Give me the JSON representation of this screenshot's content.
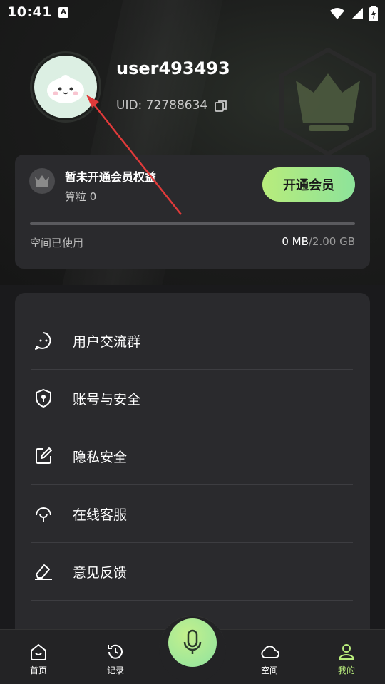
{
  "status_bar": {
    "time": "10:41",
    "a_badge": "A"
  },
  "profile": {
    "username": "user493493",
    "uid_label": "UID: 72788634"
  },
  "vip": {
    "title": "暂未开通会员权益",
    "points": "算粒 0",
    "button_label": "开通会员",
    "space_label": "空间已使用",
    "space_used": "0 MB",
    "space_total": "/2.00 GB",
    "space_fraction": 0
  },
  "menu": {
    "items": [
      {
        "label": "用户交流群",
        "icon": "chat-icon"
      },
      {
        "label": "账号与安全",
        "icon": "shield-icon"
      },
      {
        "label": "隐私安全",
        "icon": "edit-icon"
      },
      {
        "label": "在线客服",
        "icon": "headset-icon"
      },
      {
        "label": "意见反馈",
        "icon": "eraser-icon"
      }
    ]
  },
  "nav": {
    "items": [
      {
        "label": "首页",
        "icon": "home-icon",
        "active": false
      },
      {
        "label": "记录",
        "icon": "history-icon",
        "active": false
      },
      {
        "label": "空间",
        "icon": "cloud-icon",
        "active": false
      },
      {
        "label": "我的",
        "icon": "user-icon",
        "active": true
      }
    ]
  },
  "colors": {
    "accent": "#b8ec7c",
    "background": "#1a1a1c",
    "card": "#2a2a2d",
    "annotation_arrow": "#e03a3a"
  }
}
